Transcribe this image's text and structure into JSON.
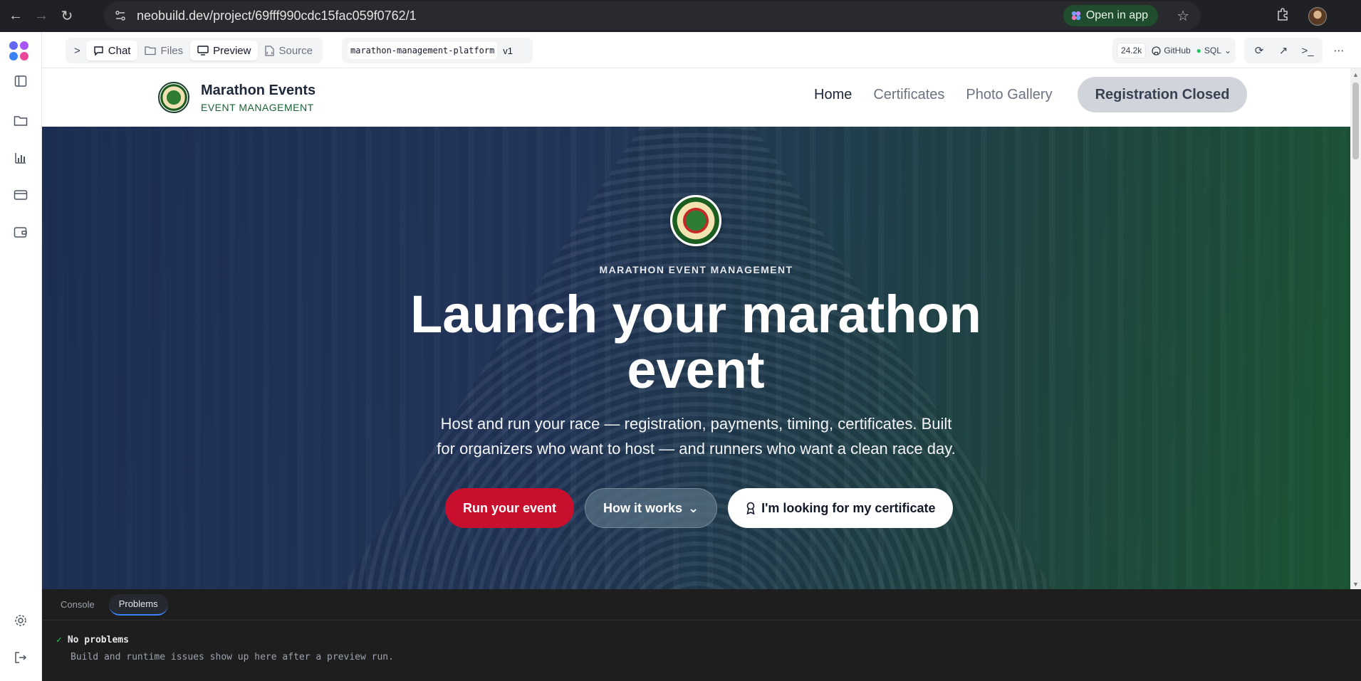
{
  "browser": {
    "url": "neobuild.dev/project/69fff990cdc15fac059f0762/1",
    "open_in_app": "Open in app"
  },
  "toolbar": {
    "tabs": [
      {
        "label": "Chat"
      },
      {
        "label": "Files"
      },
      {
        "label": "Preview"
      },
      {
        "label": "Source"
      }
    ],
    "project_name": "marathon-management-platform",
    "version": "v1",
    "token_count": "24.2k",
    "github_label": "GitHub",
    "db_label": "SQL"
  },
  "site": {
    "brand_name": "Marathon Events",
    "brand_sub": "EVENT MANAGEMENT",
    "nav": [
      {
        "label": "Home"
      },
      {
        "label": "Certificates"
      },
      {
        "label": "Photo Gallery"
      }
    ],
    "registration_button": "Registration Closed"
  },
  "hero": {
    "eyebrow": "MARATHON EVENT MANAGEMENT",
    "title": "Launch your marathon event",
    "description": "Host and run your race — registration, payments, timing, certificates. Built for organizers who want to host — and runners who want a clean race day.",
    "cta_primary": "Run your event",
    "cta_secondary": "How it works",
    "cta_light": "I'm looking for my certificate"
  },
  "panel": {
    "tabs": [
      {
        "label": "Console"
      },
      {
        "label": "Problems"
      }
    ],
    "status": "No problems",
    "status_sub": "Build and runtime issues show up here after a preview run."
  },
  "colors": {
    "accent_red": "#c8102e",
    "brand_green": "#166534",
    "chrome_bg": "#202124"
  }
}
